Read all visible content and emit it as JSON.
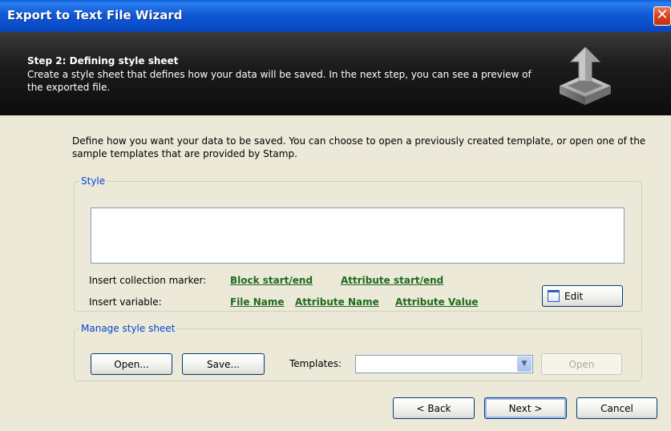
{
  "window": {
    "title": "Export to Text File Wizard",
    "close_glyph": "✕"
  },
  "header": {
    "step_title": "Step 2: Defining style sheet",
    "step_description": "Create a style sheet that defines how your data will be saved. In the next step, you can see a preview of the exported file.",
    "icon": "export-arrow-icon"
  },
  "intro_text": "Define how you want your data to be saved. You can choose to open a previously created template, or open one of the sample templates that are provided by Stamp.",
  "style_group": {
    "legend": "Style",
    "textarea_value": "",
    "collection_marker_label": "Insert collection marker:",
    "collection_marker_links": [
      "Block start/end",
      "Attribute start/end"
    ],
    "variable_label": "Insert variable:",
    "variable_links": [
      "File Name",
      "Attribute Name",
      "Attribute Value"
    ],
    "edit_button": "Edit"
  },
  "manage_group": {
    "legend": "Manage style sheet",
    "open_button": "Open...",
    "save_button": "Save...",
    "templates_label": "Templates:",
    "templates_value": "",
    "templates_open_button": "Open"
  },
  "footer": {
    "back_button": "< Back",
    "next_button": "Next >",
    "cancel_button": "Cancel"
  },
  "colors": {
    "titlebar": "#0a4dc8",
    "header_bg": "#111111",
    "dialog_bg": "#ece9d8",
    "link_green": "#1e6a1e",
    "legend_blue": "#0046d5"
  }
}
